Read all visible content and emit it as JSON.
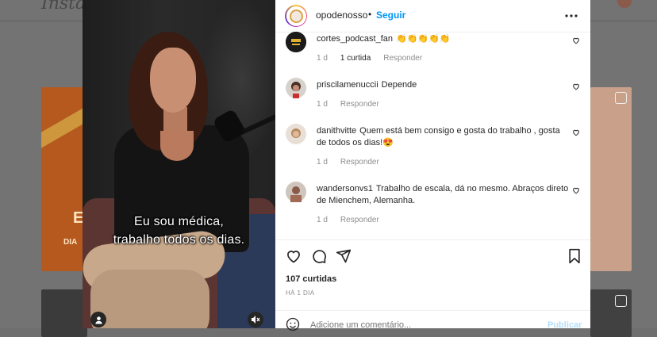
{
  "background": {
    "logo": "Instagram",
    "left_card_text": "DIA",
    "left_card_big": "E"
  },
  "video": {
    "subtitle_line1": "Eu sou médica,",
    "subtitle_line2": "trabalho todos os dias."
  },
  "post_header": {
    "username": "opodenosso",
    "separator": "•",
    "follow_label": "Seguir",
    "more_icon": "more-horizontal-icon"
  },
  "comments": [
    {
      "username": "cortes_podcast_fan",
      "text": "👏👏👏👏👏",
      "time": "1 d",
      "likes_label": "1 curtida",
      "reply_label": "Responder",
      "avatar_color": "#1b1b1b"
    },
    {
      "username": "priscilamenuccii",
      "text": "Depende",
      "time": "1 d",
      "likes_label": "",
      "reply_label": "Responder",
      "avatar_color": "#7a5040"
    },
    {
      "username": "danithvitte",
      "text": "Quem está bem consigo e gosta do trabalho , gosta de todos os dias!😍",
      "time": "1 d",
      "likes_label": "",
      "reply_label": "Responder",
      "avatar_color": "#c9a27f"
    },
    {
      "username": "wandersonvs1",
      "text": "Trabalho de escala, dá no mesmo. Abraços direto de Mienchem, Alemanha.",
      "time": "1 d",
      "likes_label": "",
      "reply_label": "Responder",
      "avatar_color": "#9a7060"
    }
  ],
  "actions": {
    "likes_text": "107 curtidas",
    "time_text": "HÁ 1 DIA",
    "comment_placeholder": "Adicione um comentário...",
    "publish_label": "Publicar"
  },
  "colors": {
    "accent": "#0095f6",
    "publish_disabled": "#b2dffc",
    "meta_gray": "#8e8e8e"
  }
}
